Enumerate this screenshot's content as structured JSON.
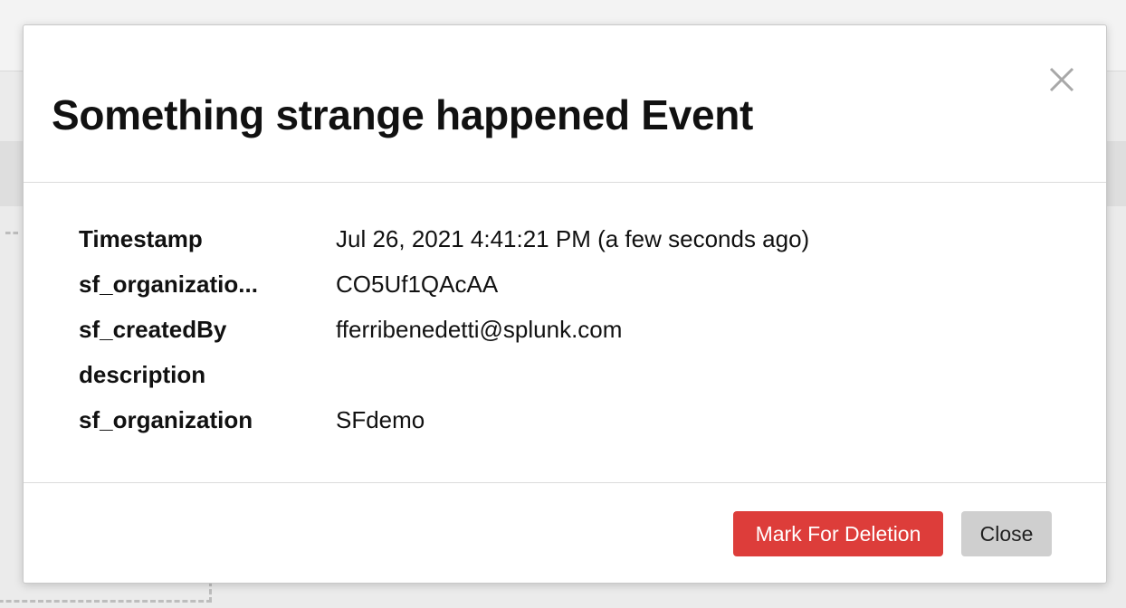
{
  "modal": {
    "title": "Something strange happened Event",
    "close_icon": "close-icon",
    "fields": [
      {
        "label": "Timestamp",
        "value": "Jul 26, 2021 4:41:21 PM (a few seconds ago)"
      },
      {
        "label": "sf_organizatio...",
        "value": "CO5Uf1QAcAA"
      },
      {
        "label": "sf_createdBy",
        "value": "fferribenedetti@splunk.com"
      },
      {
        "label": "description",
        "value": ""
      },
      {
        "label": "sf_organization",
        "value": "SFdemo"
      }
    ],
    "buttons": {
      "mark_for_deletion": "Mark For Deletion",
      "close": "Close"
    }
  },
  "colors": {
    "danger": "#dd3d3a",
    "secondary": "#cfcfcf",
    "text": "#111111",
    "divider": "#dcdcdc"
  }
}
